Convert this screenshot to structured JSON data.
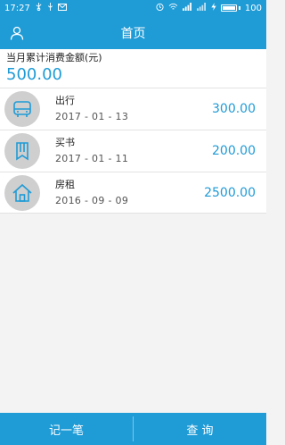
{
  "status_bar": {
    "time": "17:27",
    "battery": "100",
    "battery_level": 1.0
  },
  "header": {
    "title": "首页"
  },
  "summary": {
    "label": "当月累计消费金额(元)",
    "amount": "500.00"
  },
  "records": [
    {
      "icon": "bus-icon",
      "name": "出行",
      "date": "2017 - 01 - 13",
      "amount": "300.00"
    },
    {
      "icon": "book-icon",
      "name": "买书",
      "date": "2017 - 01 - 11",
      "amount": "200.00"
    },
    {
      "icon": "house-icon",
      "name": "房租",
      "date": "2016 - 09 - 09",
      "amount": "2500.00"
    }
  ],
  "footer": {
    "add_label": "记一笔",
    "query_label": "查 询"
  },
  "colors": {
    "primary": "#1f9bd6",
    "icon_bg": "#cfcfcf",
    "icon_fg": "#1f9bd6"
  }
}
